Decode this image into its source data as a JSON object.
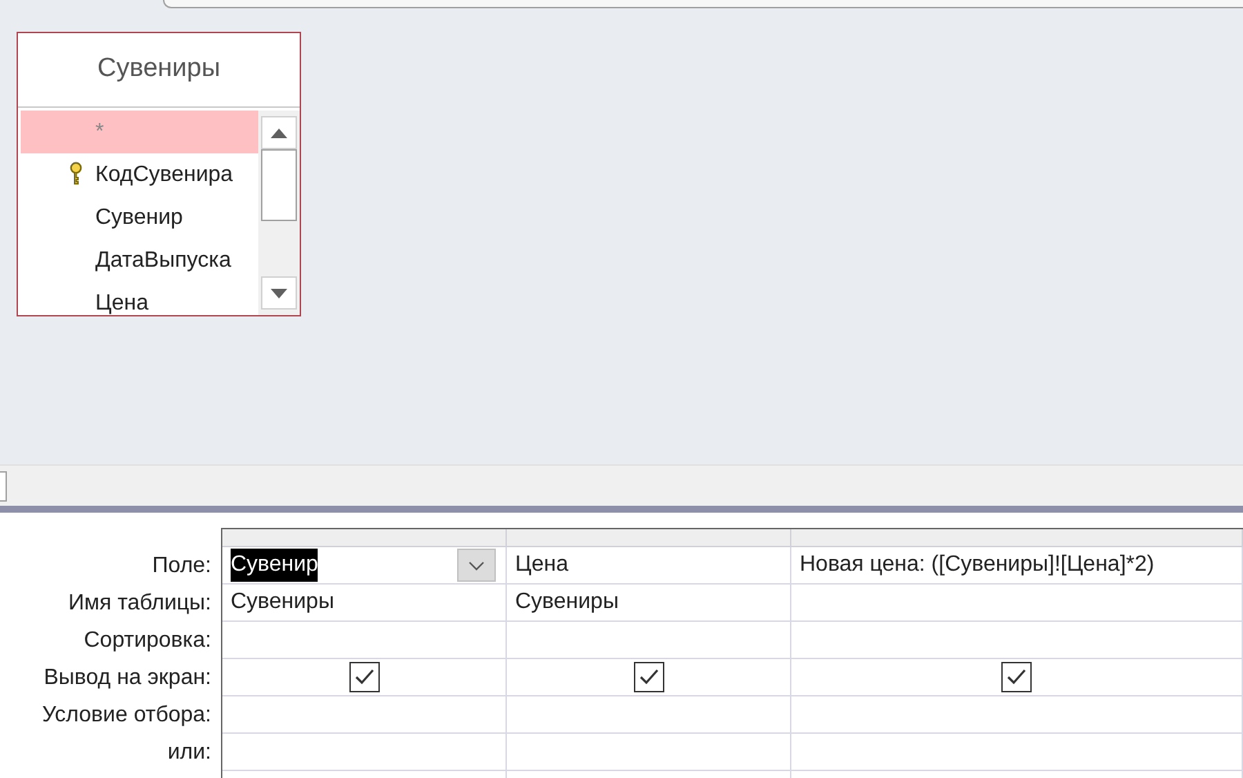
{
  "table_box": {
    "title": "Сувениры",
    "fields": [
      {
        "name": "*",
        "primary_key": false,
        "selected": true
      },
      {
        "name": "КодСувенира",
        "primary_key": true,
        "selected": false
      },
      {
        "name": "Сувенир",
        "primary_key": false,
        "selected": false
      },
      {
        "name": "ДатаВыпуска",
        "primary_key": false,
        "selected": false
      },
      {
        "name": "Цена",
        "primary_key": false,
        "selected": false
      }
    ]
  },
  "design_grid": {
    "row_labels": [
      {
        "label": "Поле:",
        "kind": "field"
      },
      {
        "label": "Имя таблицы:",
        "kind": "table"
      },
      {
        "label": "Сортировка:",
        "kind": "sort"
      },
      {
        "label": "Вывод на экран:",
        "kind": "show"
      },
      {
        "label": "Условие отбора:",
        "kind": "criteria"
      },
      {
        "label": "или:",
        "kind": "or"
      }
    ],
    "columns": [
      {
        "field": "Сувенир",
        "table": "Сувениры",
        "show": true,
        "selected": true
      },
      {
        "field": "Цена",
        "table": "Сувениры",
        "show": true,
        "selected": false
      },
      {
        "field": "Новая цена: ([Сувениры]![Цена]*2)",
        "show": true,
        "selected": false
      }
    ]
  }
}
